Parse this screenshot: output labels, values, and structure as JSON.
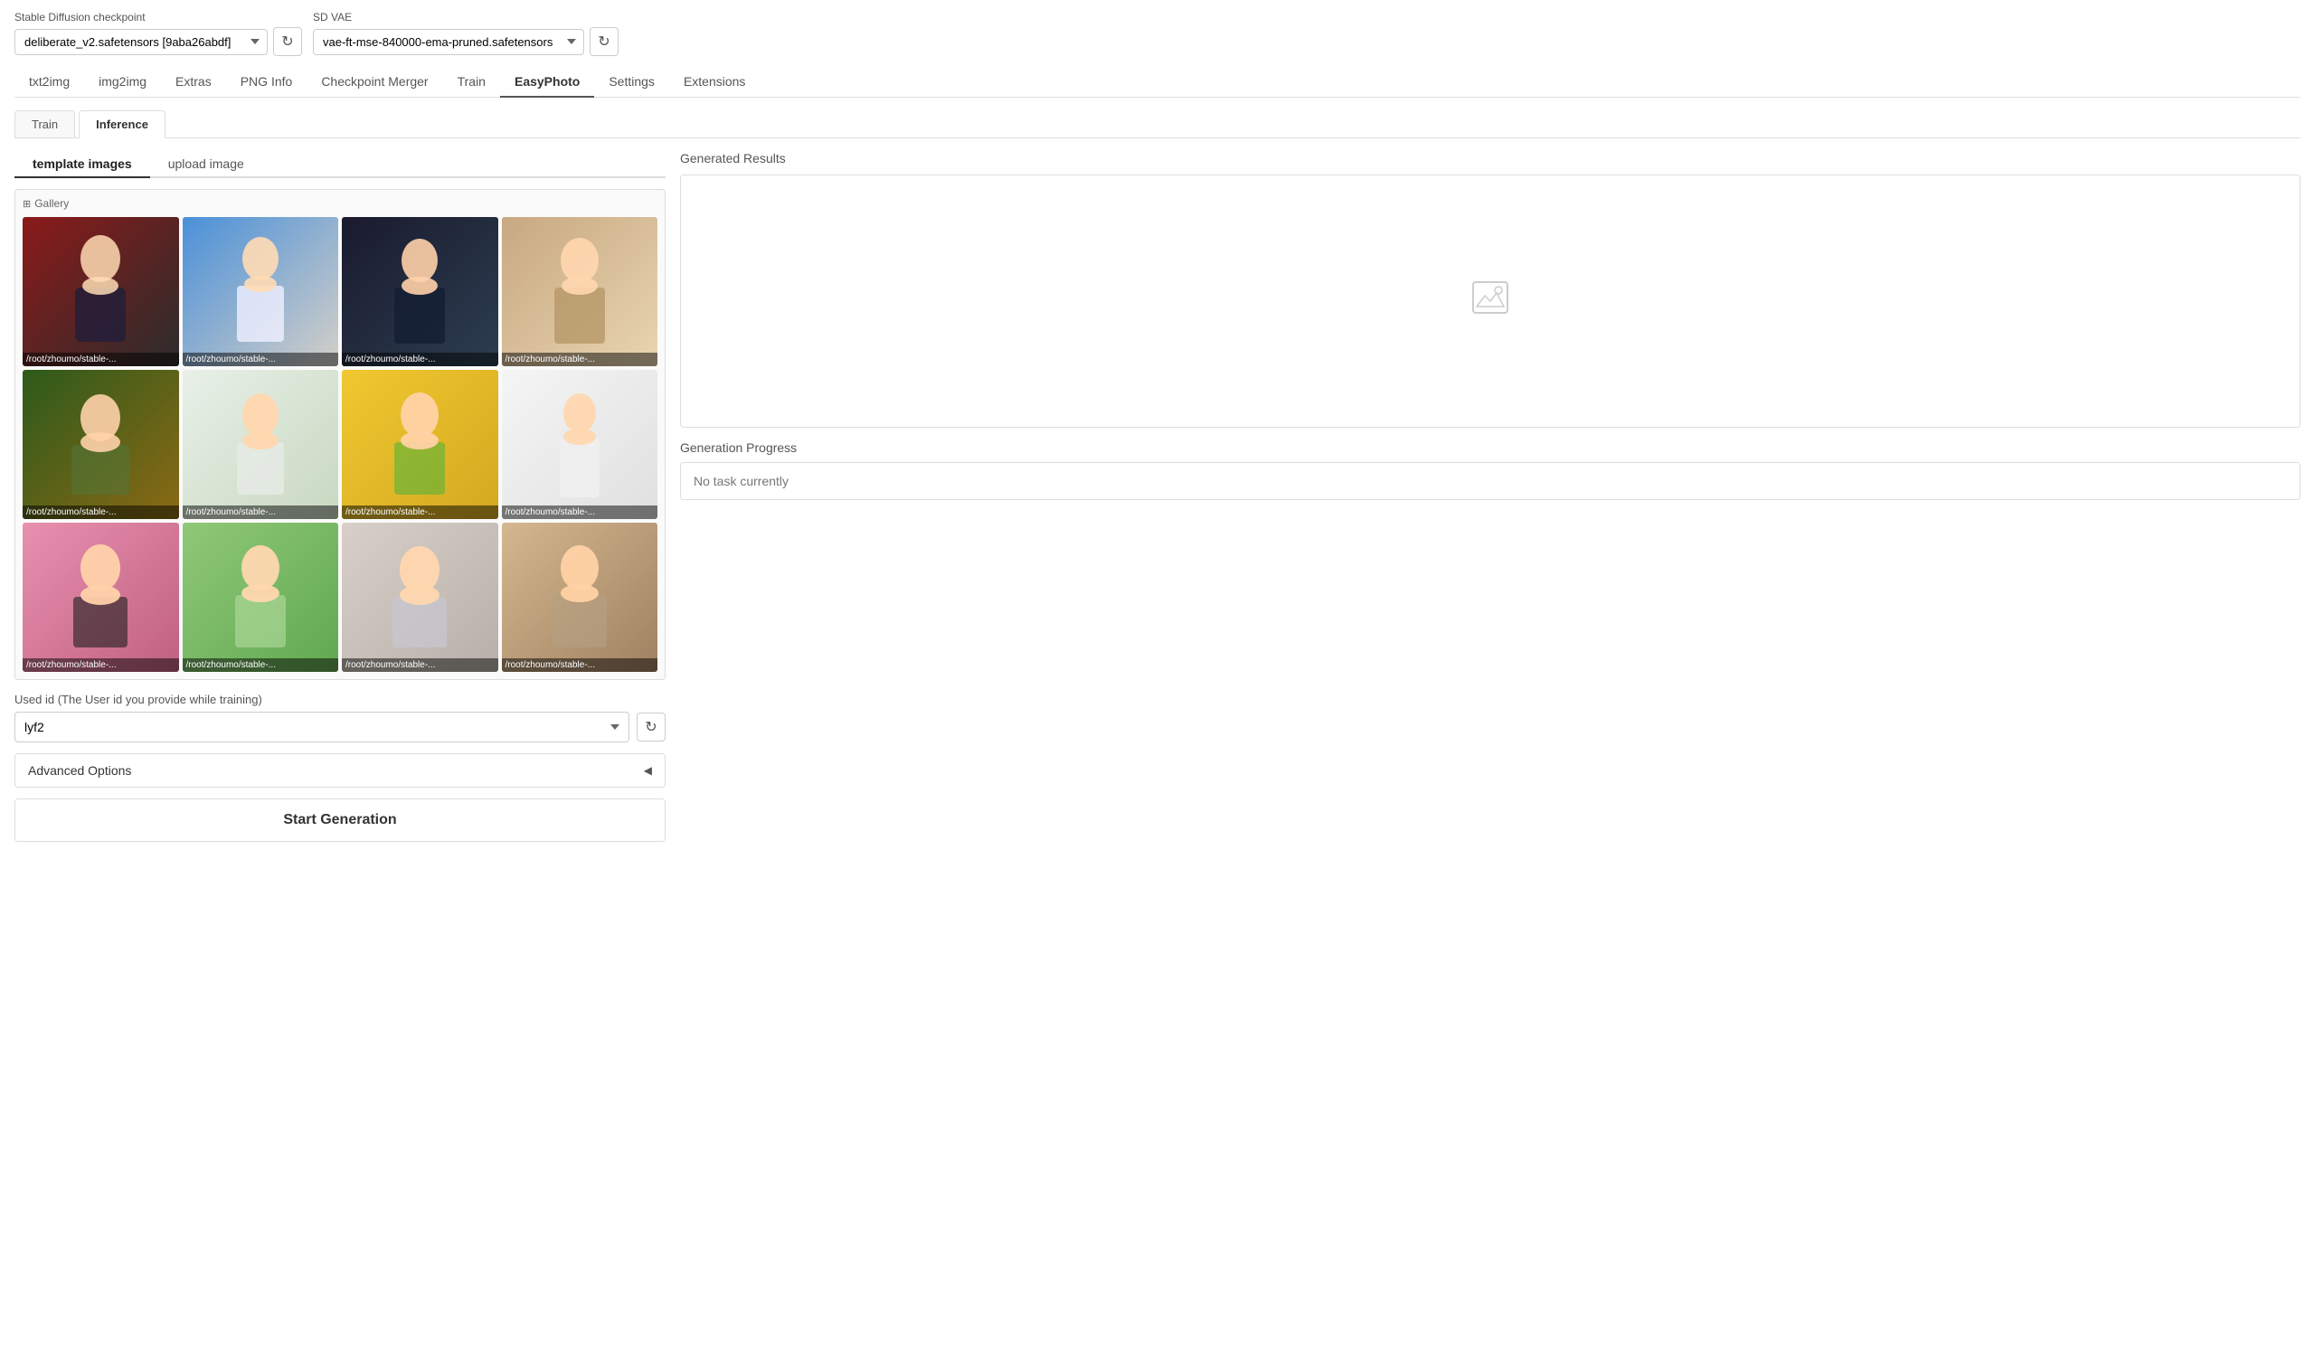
{
  "app": {
    "checkpoint_label": "Stable Diffusion checkpoint",
    "checkpoint_value": "deliberate_v2.safetensors [9aba26abdf]",
    "vae_label": "SD VAE",
    "vae_value": "vae-ft-mse-840000-ema-pruned.safetensors"
  },
  "nav": {
    "tabs": [
      {
        "id": "txt2img",
        "label": "txt2img"
      },
      {
        "id": "img2img",
        "label": "img2img"
      },
      {
        "id": "extras",
        "label": "Extras"
      },
      {
        "id": "pnginfo",
        "label": "PNG Info"
      },
      {
        "id": "checkpoint",
        "label": "Checkpoint Merger"
      },
      {
        "id": "train",
        "label": "Train"
      },
      {
        "id": "easyphoto",
        "label": "EasyPhoto"
      },
      {
        "id": "settings",
        "label": "Settings"
      },
      {
        "id": "extensions",
        "label": "Extensions"
      }
    ],
    "active": "easyphoto"
  },
  "sub_tabs": [
    {
      "id": "train",
      "label": "Train"
    },
    {
      "id": "inference",
      "label": "Inference"
    }
  ],
  "sub_tab_active": "inference",
  "image_tabs": [
    {
      "id": "template",
      "label": "template images"
    },
    {
      "id": "upload",
      "label": "upload image"
    }
  ],
  "image_tab_active": "template",
  "gallery": {
    "label": "Gallery",
    "images": [
      {
        "id": 1,
        "path": "/root/zhoumo/stable-...",
        "color": "person-1",
        "emoji": "👩"
      },
      {
        "id": 2,
        "path": "/root/zhoumo/stable-...",
        "color": "person-2",
        "emoji": "👦"
      },
      {
        "id": 3,
        "path": "/root/zhoumo/stable-...",
        "color": "person-3",
        "emoji": "🧑"
      },
      {
        "id": 4,
        "path": "/root/zhoumo/stable-...",
        "color": "person-4",
        "emoji": "👩"
      },
      {
        "id": 5,
        "path": "/root/zhoumo/stable-...",
        "color": "person-5",
        "emoji": "👩"
      },
      {
        "id": 6,
        "path": "/root/zhoumo/stable-...",
        "color": "person-6",
        "emoji": "👧"
      },
      {
        "id": 7,
        "path": "/root/zhoumo/stable-...",
        "color": "person-7",
        "emoji": "👩"
      },
      {
        "id": 8,
        "path": "/root/zhoumo/stable-...",
        "color": "person-8",
        "emoji": "🧍"
      },
      {
        "id": 9,
        "path": "/root/zhoumo/stable-...",
        "color": "person-9",
        "emoji": "👩"
      },
      {
        "id": 10,
        "path": "/root/zhoumo/stable-...",
        "color": "person-10",
        "emoji": "👧"
      },
      {
        "id": 11,
        "path": "/root/zhoumo/stable-...",
        "color": "person-11",
        "emoji": "👩"
      },
      {
        "id": 12,
        "path": "/root/zhoumo/stable-...",
        "color": "person-12",
        "emoji": "👩"
      }
    ]
  },
  "user_id": {
    "label": "Used id (The User id you provide while training)",
    "value": "lyf2"
  },
  "advanced_options": {
    "label": "Advanced Options"
  },
  "start_button": {
    "label": "Start Generation"
  },
  "right_panel": {
    "generated_results_label": "Generated Results",
    "generation_progress_label": "Generation Progress",
    "no_task": "No task currently"
  }
}
